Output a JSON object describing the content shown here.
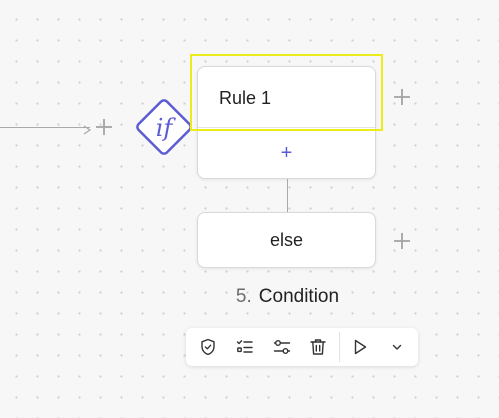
{
  "canvas": {
    "background": "#f7f7f7"
  },
  "condition_node": {
    "if_label": "if",
    "accent_color": "#5b5bd6",
    "rules": [
      {
        "label": "Rule 1"
      }
    ],
    "add_rule_symbol": "+",
    "else_label": "else",
    "step_number": "5.",
    "title": "Condition",
    "highlight_color": "#ecec1c"
  },
  "toolbar": {
    "buttons": [
      {
        "icon": "shield-check-icon"
      },
      {
        "icon": "checklist-icon"
      },
      {
        "icon": "sliders-icon"
      },
      {
        "icon": "trash-icon"
      },
      {
        "icon": "play-icon"
      },
      {
        "icon": "chevron-down-icon"
      }
    ]
  }
}
